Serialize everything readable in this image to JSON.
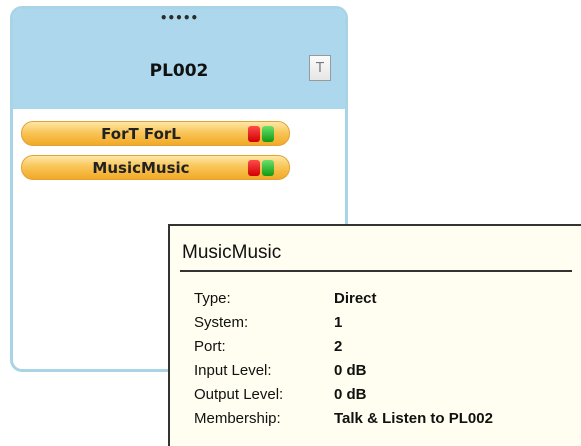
{
  "panel": {
    "drag_handle": "•••••",
    "title": "PL002",
    "t_button_label": "T",
    "members": [
      {
        "label": "ForT ForL",
        "talk_led": "red",
        "listen_led": "green"
      },
      {
        "label": "MusicMusic",
        "talk_led": "red",
        "listen_led": "green"
      }
    ]
  },
  "tooltip": {
    "title": "MusicMusic",
    "properties": [
      {
        "key": "Type:",
        "value": "Direct"
      },
      {
        "key": "System:",
        "value": "1"
      },
      {
        "key": "Port:",
        "value": "2"
      },
      {
        "key": "Input Level:",
        "value": "0 dB"
      },
      {
        "key": "Output Level:",
        "value": "0 dB"
      },
      {
        "key": "Membership:",
        "value": "Talk & Listen to PL002"
      }
    ]
  },
  "colors": {
    "header_blue": "#acd7ec",
    "panel_border": "#a9d3e6",
    "member_orange": "#f9c65a",
    "led_red": "#d10000",
    "led_green": "#129a12",
    "tooltip_bg": "#fffef0"
  }
}
